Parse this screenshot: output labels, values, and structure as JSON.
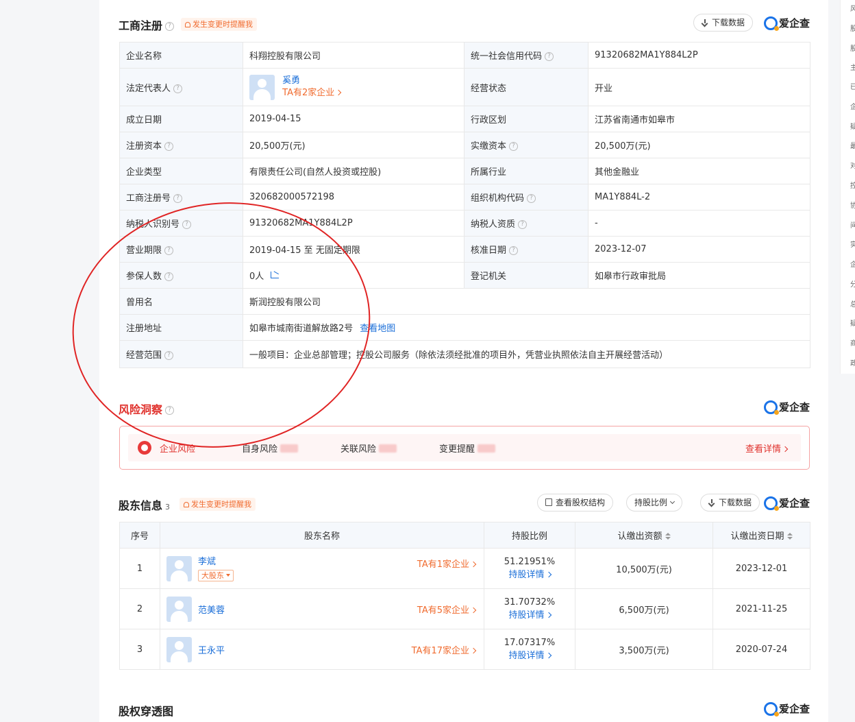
{
  "registration": {
    "title": "工商注册",
    "remind": "发生变更时提醒我",
    "download": "下载数据",
    "logo": "爱企查",
    "rows": {
      "name_label": "企业名称",
      "name_value": "科翔控股有限公司",
      "credit_label": "统一社会信用代码",
      "credit_value": "91320682MA1Y884L2P",
      "legal_label": "法定代表人",
      "legal_name": "奚勇",
      "legal_link": "TA有2家企业",
      "status_label": "经营状态",
      "status_value": "开业",
      "found_label": "成立日期",
      "found_value": "2019-04-15",
      "region_label": "行政区划",
      "region_value": "江苏省南通市如皋市",
      "capital_label": "注册资本",
      "capital_value": "20,500万(元)",
      "paid_label": "实缴资本",
      "paid_value": "20,500万(元)",
      "type_label": "企业类型",
      "type_value": "有限责任公司(自然人投资或控股)",
      "industry_label": "所属行业",
      "industry_value": "其他金融业",
      "regno_label": "工商注册号",
      "regno_value": "320682000572198",
      "orgcode_label": "组织机构代码",
      "orgcode_value": "MA1Y884L-2",
      "taxid_label": "纳税人识别号",
      "taxid_value": "91320682MA1Y884L2P",
      "taxqual_label": "纳税人资质",
      "taxqual_value": "-",
      "term_label": "营业期限",
      "term_value": "2019-04-15 至 无固定期限",
      "approve_label": "核准日期",
      "approve_value": "2023-12-07",
      "insured_label": "参保人数",
      "insured_value": "0人",
      "authority_label": "登记机关",
      "authority_value": "如皋市行政审批局",
      "former_label": "曾用名",
      "former_value": "斯润控股有限公司",
      "address_label": "注册地址",
      "address_value": "如皋市城南街道解放路2号",
      "address_link": "查看地图",
      "scope_label": "经营范围",
      "scope_value": "一般项目：企业总部管理；控股公司服务（除依法须经批准的项目外，凭营业执照依法自主开展经营活动）"
    }
  },
  "risk": {
    "title": "风险洞察",
    "logo": "爱企查",
    "items": [
      "企业风险",
      "自身风险",
      "关联风险",
      "变更提醒"
    ],
    "detail": "查看详情"
  },
  "shareholders": {
    "title": "股东信息",
    "count": "3",
    "remind": "发生变更时提醒我",
    "structure_btn": "查看股权结构",
    "ratio_btn": "持股比例",
    "download": "下载数据",
    "logo": "爱企查",
    "headers": [
      "序号",
      "股东名称",
      "持股比例",
      "认缴出资额",
      "认缴出资日期"
    ],
    "rows": [
      {
        "no": "1",
        "name": "李斌",
        "tag": "大股东",
        "companies": "TA有1家企业",
        "ratio": "51.21951%",
        "detail": "持股详情",
        "amount": "10,500万(元)",
        "date": "2023-12-01"
      },
      {
        "no": "2",
        "name": "范美蓉",
        "tag": "",
        "companies": "TA有5家企业",
        "ratio": "31.70732%",
        "detail": "持股详情",
        "amount": "6,500万(元)",
        "date": "2021-11-25"
      },
      {
        "no": "3",
        "name": "王永平",
        "tag": "",
        "companies": "TA有17家企业",
        "ratio": "17.07317%",
        "detail": "持股详情",
        "amount": "3,500万(元)",
        "date": "2020-07-24"
      }
    ]
  },
  "equity": {
    "title": "股权穿透图",
    "logo": "爱企查"
  },
  "rail": [
    "风",
    "股",
    "股",
    "主",
    "已",
    "企",
    "疑",
    "最",
    "对",
    "控",
    "协",
    "间",
    "实",
    "企",
    "分",
    "总",
    "疑",
    "商",
    "政"
  ],
  "colors": {
    "accent_blue": "#1a6ed8",
    "accent_orange": "#f06b2f",
    "risk_red": "#e0322d",
    "annotation": "#e02424"
  }
}
